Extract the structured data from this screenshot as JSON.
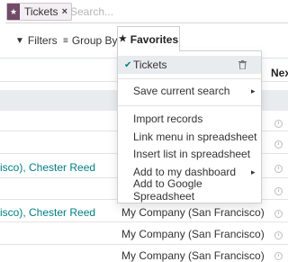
{
  "search": {
    "facet_label": "Tickets",
    "facet_remove": "×",
    "placeholder": "Search..."
  },
  "toolbar": {
    "filters_label": "Filters",
    "groupby_label": "Group By",
    "favorites_label": "Favorites"
  },
  "list": {
    "next_column_header": "Nex",
    "rows": [
      {
        "customer": "isco), Chester Reed",
        "company": ""
      },
      {
        "customer": "isco), Chester Reed",
        "company": "My Company (San Francisco)"
      },
      {
        "customer": "",
        "company": "My Company (San Francisco)"
      },
      {
        "customer": "",
        "company": "My Company (San Francisco)"
      }
    ]
  },
  "favorites_menu": {
    "current_filter": "Tickets",
    "save_current_search": "Save current search",
    "import_records": "Import records",
    "link_menu_spreadsheet": "Link menu in spreadsheet",
    "insert_list_spreadsheet": "Insert list in spreadsheet",
    "add_to_dashboard": "Add to my dashboard",
    "add_to_google_spreadsheet": "Add to Google Spreadsheet"
  },
  "colors": {
    "brand": "#714b67",
    "link": "#017e84",
    "group_row_bg": "#e9ecef"
  }
}
